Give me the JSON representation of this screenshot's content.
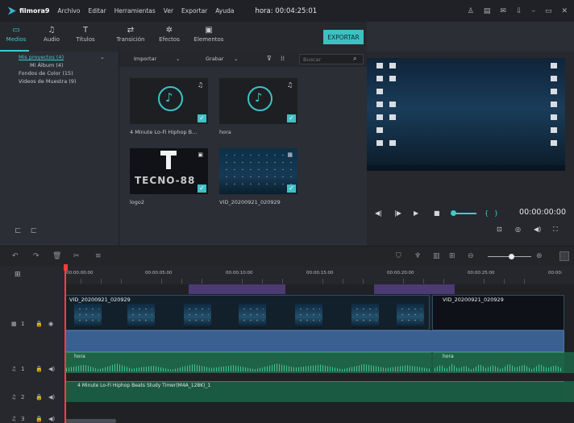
{
  "menubar": {
    "app_name": "filmora9",
    "items": [
      "Archivo",
      "Editar",
      "Herramientas",
      "Ver",
      "Exportar",
      "Ayuda"
    ],
    "time_label": "hora:  00:04:25:01"
  },
  "media_tabs": [
    {
      "label": "Medios",
      "icon": "folder-icon"
    },
    {
      "label": "Audio",
      "icon": "music-icon"
    },
    {
      "label": "Títulos",
      "icon": "text-icon"
    },
    {
      "label": "Transición",
      "icon": "transition-icon"
    },
    {
      "label": "Efectos",
      "icon": "effects-icon"
    },
    {
      "label": "Elementos",
      "icon": "image-icon"
    }
  ],
  "export_label": "EXPORTAR",
  "tree": {
    "items": [
      "Mis proyectos (4)",
      "Mi Álbum (4)",
      "Fondos de Color (15)",
      "Videos de Muestra (9)"
    ]
  },
  "library": {
    "import_label": "Importar",
    "record_label": "Grabar",
    "search_placeholder": "Buscar",
    "thumbs": [
      "4 Minute Lo-Fi Hiphop B...",
      "hora",
      "logo2",
      "VID_20200921_020929"
    ],
    "logo_text": "TECNO-88"
  },
  "preview": {
    "timecode": "00:00:00:00"
  },
  "timeline": {
    "ticks": [
      "00:00:00:00",
      "00:00:05:00",
      "00:00:10:00",
      "00:00:15:00",
      "00:00:20:00",
      "00:00:25:00",
      "00:00:"
    ],
    "video_clip_1": "VID_20200921_020929",
    "video_clip_2": "VID_20200921_020929",
    "audio_clip_1a": "hora",
    "audio_clip_1b": "hora",
    "audio_clip_2": "4 Minute Lo-Fi Hiphop Beats Study Timer(M4A_128K)_1",
    "track_video_num": "1",
    "track_audio_nums": [
      "1",
      "2",
      "3"
    ]
  },
  "colors": {
    "accent": "#3ecbd0",
    "playhead": "#ff4040",
    "audio_track": "#1e6348",
    "blue_track": "#3a5f91",
    "purple_marker": "#4c3a73"
  }
}
